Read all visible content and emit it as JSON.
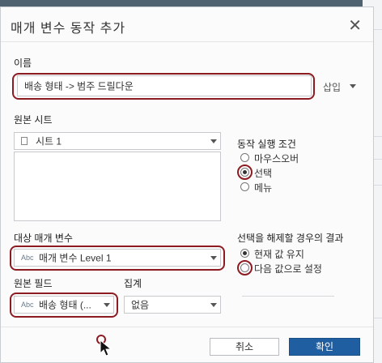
{
  "dialog": {
    "title": "매개 변수 동작 추가",
    "close_glyph": "✕"
  },
  "name_section": {
    "label": "이름",
    "value": "배송 형태 -> 범주 드릴다운",
    "insert_label": "삽입"
  },
  "source_sheets": {
    "label": "원본 시트",
    "selected": "시트 1"
  },
  "run_action_on": {
    "label": "동작 실행 조건",
    "options": [
      "마우스오버",
      "선택",
      "메뉴"
    ],
    "selected": "선택"
  },
  "target_parameter": {
    "label": "대상 매개 변수",
    "type_tag": "Abc",
    "value": "매개 변수 Level 1"
  },
  "clearing_selection": {
    "label": "선택을 해제할 경우의 결과",
    "options": [
      "현재 값 유지",
      "다음 값으로 설정"
    ],
    "selected": "현재 값 유지"
  },
  "source_field": {
    "label": "원본 필드",
    "type_tag": "Abc",
    "value": "배송 형태 (..."
  },
  "aggregation": {
    "label": "집계",
    "value": "없음"
  },
  "footer": {
    "cancel_label": "취소",
    "ok_label": "확인"
  },
  "colors": {
    "highlight_ring": "#8c1c22",
    "ok_button": "#1f5ea0"
  }
}
